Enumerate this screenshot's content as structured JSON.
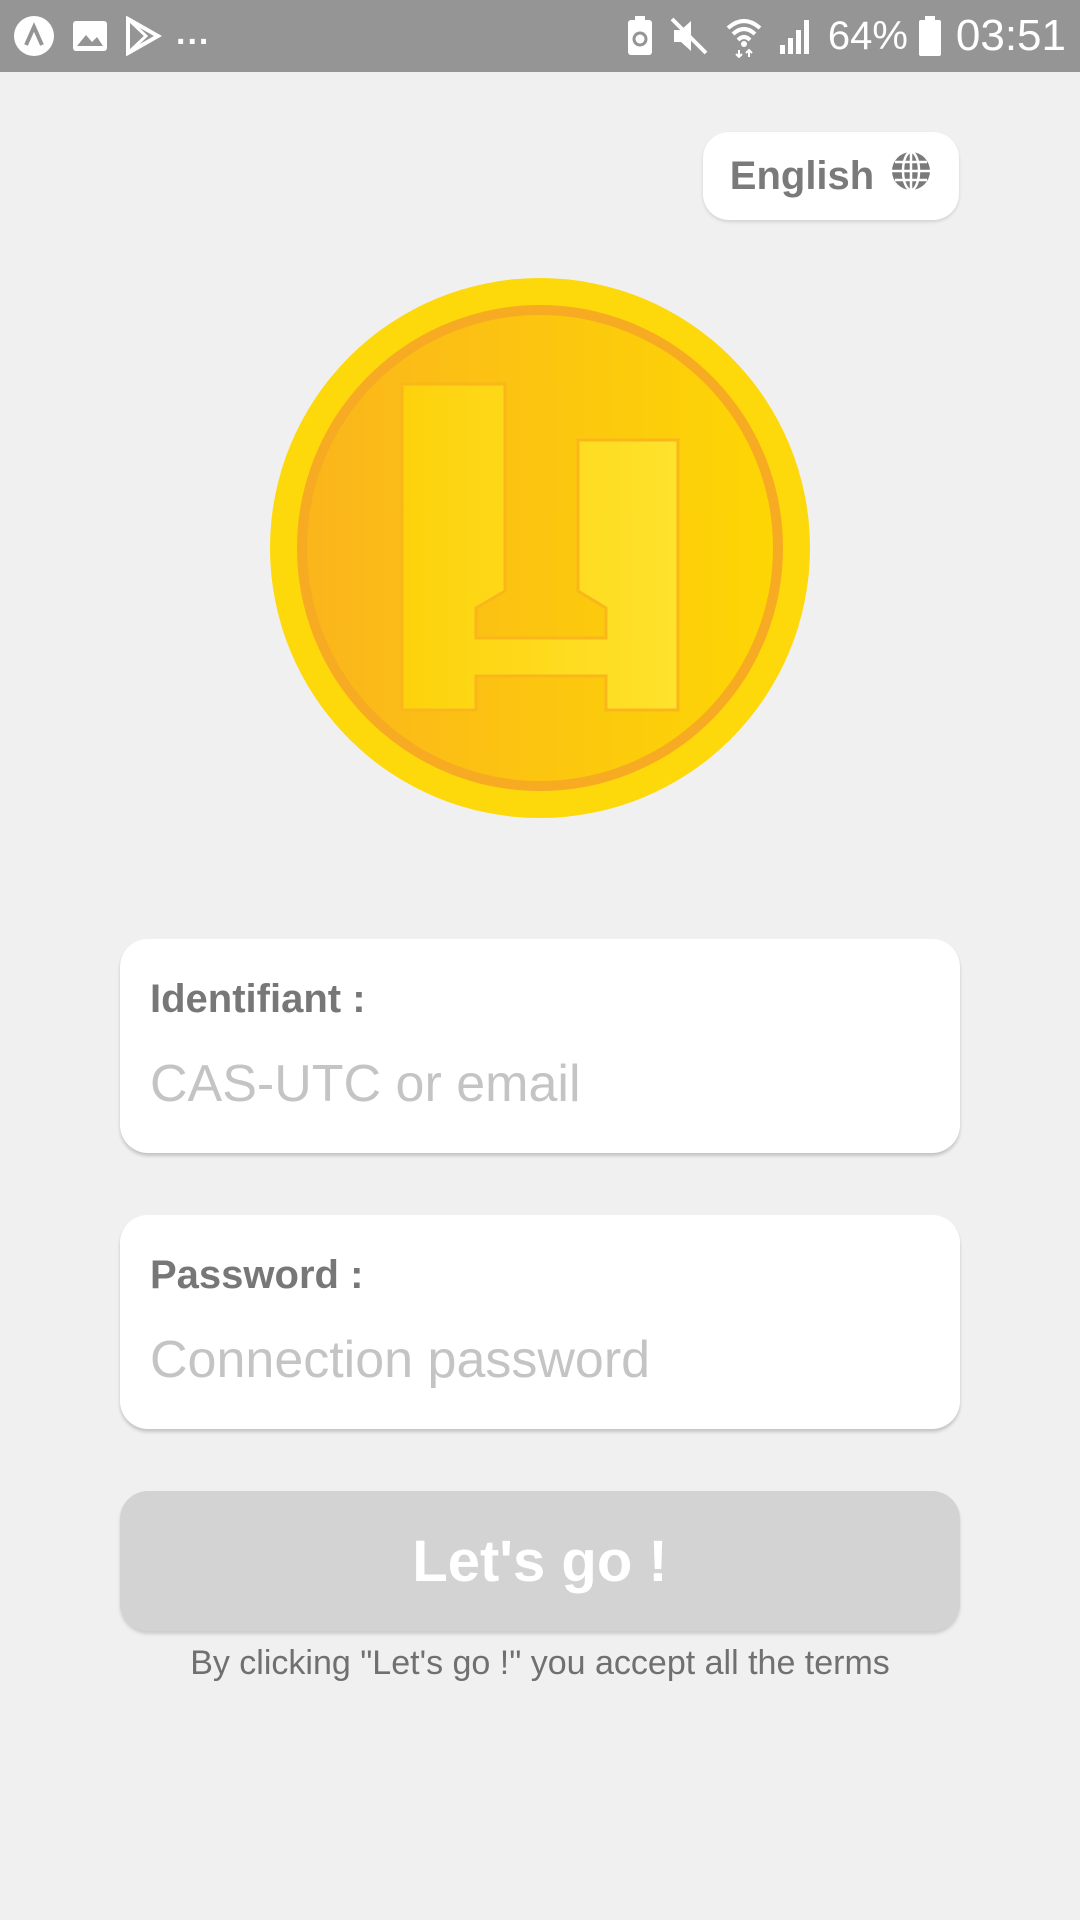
{
  "status_bar": {
    "icons_left": [
      "app-icon",
      "image-icon",
      "play-store-icon"
    ],
    "overflow": "...",
    "icons_right": [
      "battery-saver-icon",
      "mute-icon",
      "wifi-icon",
      "signal-icon",
      "battery-icon"
    ],
    "battery_percent": "64%",
    "time": "03:51"
  },
  "language_selector": {
    "label": "English",
    "icon": "globe-icon"
  },
  "logo": {
    "icon": "coin-logo-icon",
    "colors": {
      "outer": "#fdd80a",
      "inner": "#fbbf1a",
      "rim": "#f7a823"
    }
  },
  "login_form": {
    "identifier": {
      "label": "Identifiant :",
      "placeholder": "CAS-UTC or email",
      "value": ""
    },
    "password": {
      "label": "Password :",
      "placeholder": "Connection password",
      "value": ""
    },
    "submit_label": "Let's go !",
    "terms_text": "By clicking \"Let's go !\" you accept all the terms"
  },
  "colors": {
    "background": "#f0f0f0",
    "status_bar": "#959595",
    "button_disabled": "#d3d3d3",
    "label_text": "#777777",
    "placeholder_text": "#c4c4c4"
  }
}
